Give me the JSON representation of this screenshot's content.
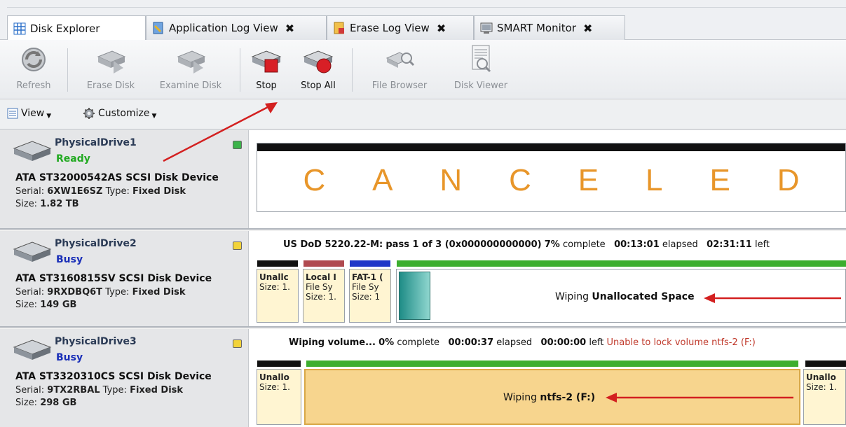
{
  "tabs": [
    {
      "label": "Disk Explorer",
      "icon": "grid-icon",
      "closable": false,
      "active": true
    },
    {
      "label": "Application Log View",
      "icon": "log-icon",
      "closable": true,
      "active": false
    },
    {
      "label": "Erase Log View",
      "icon": "erase-log-icon",
      "closable": true,
      "active": false
    },
    {
      "label": "SMART Monitor",
      "icon": "monitor-icon",
      "closable": true,
      "active": false
    }
  ],
  "close_glyph": "✖",
  "toolbar": {
    "refresh": "Refresh",
    "erase_disk": "Erase Disk",
    "examine_disk": "Examine Disk",
    "stop": "Stop",
    "stop_all": "Stop All",
    "file_browser": "File Browser",
    "disk_viewer": "Disk Viewer"
  },
  "subbar": {
    "view": "View",
    "customize": "Customize"
  },
  "drives": [
    {
      "name": "PhysicalDrive1",
      "status": "Ready",
      "status_color": "#22aa22",
      "led_color": "#3cb34a",
      "model": "ATA ST32000542AS SCSI Disk Device",
      "serial_label": "Serial: ",
      "serial": "6XW1E6SZ",
      "type_label": " Type: ",
      "type": "Fixed Disk",
      "size_label": "Size: ",
      "size": "1.82 TB",
      "canceled_letters": [
        "C",
        "A",
        "N",
        "C",
        "E",
        "L",
        "E",
        "D"
      ]
    },
    {
      "name": "PhysicalDrive2",
      "status": "Busy",
      "status_color": "#1a2fb8",
      "led_color": "#f2d33a",
      "model": "ATA ST3160815SV SCSI Disk Device",
      "serial_label": "Serial: ",
      "serial": "9RXDBQ6T",
      "type_label": " Type: ",
      "type": "Fixed Disk",
      "size_label": "Size: ",
      "size": "149 GB",
      "progress": {
        "method": "US DoD 5220.22-M:",
        "pass": "pass 1 of 3 (0x000000000000)",
        "percent": "7%",
        "complete_label": "complete",
        "elapsed": "00:13:01",
        "elapsed_label": "elapsed",
        "left": "02:31:11",
        "left_label": "left"
      },
      "partitions": [
        {
          "line1": "Unallc",
          "line2": "Size: 1.",
          "line3": "",
          "bar_color": "#111111"
        },
        {
          "line1": "Local I",
          "line2": "File Sy",
          "line3": "Size: 1.",
          "bar_color": "#b04a50"
        },
        {
          "line1": "FAT-1 (",
          "line2": "File Sy",
          "line3": "Size: 1",
          "bar_color": "#1f36c8"
        }
      ],
      "wipe_prefix": "Wiping",
      "wipe_target": "Unallocated Space",
      "wipe_percent": 7
    },
    {
      "name": "PhysicalDrive3",
      "status": "Busy",
      "status_color": "#1a2fb8",
      "led_color": "#f2d33a",
      "model": "ATA ST3320310CS SCSI Disk Device",
      "serial_label": "Serial: ",
      "serial": "9TX2RBAL",
      "type_label": " Type: ",
      "type": "Fixed Disk",
      "size_label": "Size: ",
      "size": "298 GB",
      "progress": {
        "method": "Wiping volume...",
        "percent": "0%",
        "complete_label": "complete",
        "elapsed": "00:00:37",
        "elapsed_label": "elapsed",
        "left": "00:00:00",
        "left_label": "left",
        "error": "Unable to lock volume ntfs-2 (F:)"
      },
      "partitions": [
        {
          "line1": "Unallo",
          "line2": "Size: 1.",
          "bar_color": "#111111"
        },
        {
          "line1": "Unallo",
          "line2": "Size: 1.",
          "bar_color": "#111111"
        }
      ],
      "wipe_prefix": "Wiping",
      "wipe_target": "ntfs-2 (F:)"
    }
  ],
  "colors": {
    "accent_green": "#3cae2f",
    "arrow_red": "#d32020",
    "canceled_orange": "#e8962a"
  }
}
